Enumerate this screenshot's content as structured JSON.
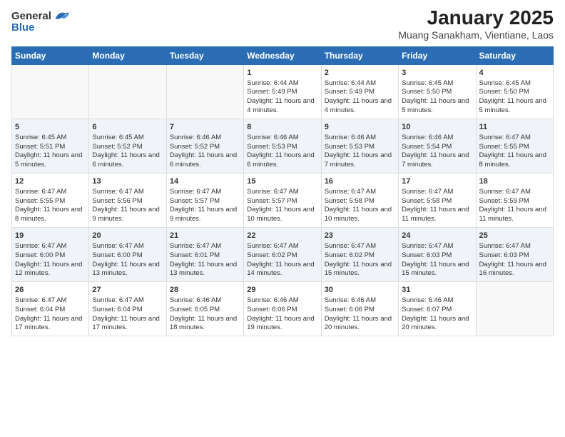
{
  "logo": {
    "line1": "General",
    "line2": "Blue"
  },
  "title": "January 2025",
  "subtitle": "Muang Sanakham, Vientiane, Laos",
  "days_of_week": [
    "Sunday",
    "Monday",
    "Tuesday",
    "Wednesday",
    "Thursday",
    "Friday",
    "Saturday"
  ],
  "weeks": [
    [
      {
        "day": "",
        "info": ""
      },
      {
        "day": "",
        "info": ""
      },
      {
        "day": "",
        "info": ""
      },
      {
        "day": "1",
        "info": "Sunrise: 6:44 AM\nSunset: 5:49 PM\nDaylight: 11 hours and 4 minutes."
      },
      {
        "day": "2",
        "info": "Sunrise: 6:44 AM\nSunset: 5:49 PM\nDaylight: 11 hours and 4 minutes."
      },
      {
        "day": "3",
        "info": "Sunrise: 6:45 AM\nSunset: 5:50 PM\nDaylight: 11 hours and 5 minutes."
      },
      {
        "day": "4",
        "info": "Sunrise: 6:45 AM\nSunset: 5:50 PM\nDaylight: 11 hours and 5 minutes."
      }
    ],
    [
      {
        "day": "5",
        "info": "Sunrise: 6:45 AM\nSunset: 5:51 PM\nDaylight: 11 hours and 5 minutes."
      },
      {
        "day": "6",
        "info": "Sunrise: 6:45 AM\nSunset: 5:52 PM\nDaylight: 11 hours and 6 minutes."
      },
      {
        "day": "7",
        "info": "Sunrise: 6:46 AM\nSunset: 5:52 PM\nDaylight: 11 hours and 6 minutes."
      },
      {
        "day": "8",
        "info": "Sunrise: 6:46 AM\nSunset: 5:53 PM\nDaylight: 11 hours and 6 minutes."
      },
      {
        "day": "9",
        "info": "Sunrise: 6:46 AM\nSunset: 5:53 PM\nDaylight: 11 hours and 7 minutes."
      },
      {
        "day": "10",
        "info": "Sunrise: 6:46 AM\nSunset: 5:54 PM\nDaylight: 11 hours and 7 minutes."
      },
      {
        "day": "11",
        "info": "Sunrise: 6:47 AM\nSunset: 5:55 PM\nDaylight: 11 hours and 8 minutes."
      }
    ],
    [
      {
        "day": "12",
        "info": "Sunrise: 6:47 AM\nSunset: 5:55 PM\nDaylight: 11 hours and 8 minutes."
      },
      {
        "day": "13",
        "info": "Sunrise: 6:47 AM\nSunset: 5:56 PM\nDaylight: 11 hours and 9 minutes."
      },
      {
        "day": "14",
        "info": "Sunrise: 6:47 AM\nSunset: 5:57 PM\nDaylight: 11 hours and 9 minutes."
      },
      {
        "day": "15",
        "info": "Sunrise: 6:47 AM\nSunset: 5:57 PM\nDaylight: 11 hours and 10 minutes."
      },
      {
        "day": "16",
        "info": "Sunrise: 6:47 AM\nSunset: 5:58 PM\nDaylight: 11 hours and 10 minutes."
      },
      {
        "day": "17",
        "info": "Sunrise: 6:47 AM\nSunset: 5:58 PM\nDaylight: 11 hours and 11 minutes."
      },
      {
        "day": "18",
        "info": "Sunrise: 6:47 AM\nSunset: 5:59 PM\nDaylight: 11 hours and 11 minutes."
      }
    ],
    [
      {
        "day": "19",
        "info": "Sunrise: 6:47 AM\nSunset: 6:00 PM\nDaylight: 11 hours and 12 minutes."
      },
      {
        "day": "20",
        "info": "Sunrise: 6:47 AM\nSunset: 6:00 PM\nDaylight: 11 hours and 13 minutes."
      },
      {
        "day": "21",
        "info": "Sunrise: 6:47 AM\nSunset: 6:01 PM\nDaylight: 11 hours and 13 minutes."
      },
      {
        "day": "22",
        "info": "Sunrise: 6:47 AM\nSunset: 6:02 PM\nDaylight: 11 hours and 14 minutes."
      },
      {
        "day": "23",
        "info": "Sunrise: 6:47 AM\nSunset: 6:02 PM\nDaylight: 11 hours and 15 minutes."
      },
      {
        "day": "24",
        "info": "Sunrise: 6:47 AM\nSunset: 6:03 PM\nDaylight: 11 hours and 15 minutes."
      },
      {
        "day": "25",
        "info": "Sunrise: 6:47 AM\nSunset: 6:03 PM\nDaylight: 11 hours and 16 minutes."
      }
    ],
    [
      {
        "day": "26",
        "info": "Sunrise: 6:47 AM\nSunset: 6:04 PM\nDaylight: 11 hours and 17 minutes."
      },
      {
        "day": "27",
        "info": "Sunrise: 6:47 AM\nSunset: 6:04 PM\nDaylight: 11 hours and 17 minutes."
      },
      {
        "day": "28",
        "info": "Sunrise: 6:46 AM\nSunset: 6:05 PM\nDaylight: 11 hours and 18 minutes."
      },
      {
        "day": "29",
        "info": "Sunrise: 6:46 AM\nSunset: 6:06 PM\nDaylight: 11 hours and 19 minutes."
      },
      {
        "day": "30",
        "info": "Sunrise: 6:46 AM\nSunset: 6:06 PM\nDaylight: 11 hours and 20 minutes."
      },
      {
        "day": "31",
        "info": "Sunrise: 6:46 AM\nSunset: 6:07 PM\nDaylight: 11 hours and 20 minutes."
      },
      {
        "day": "",
        "info": ""
      }
    ]
  ]
}
